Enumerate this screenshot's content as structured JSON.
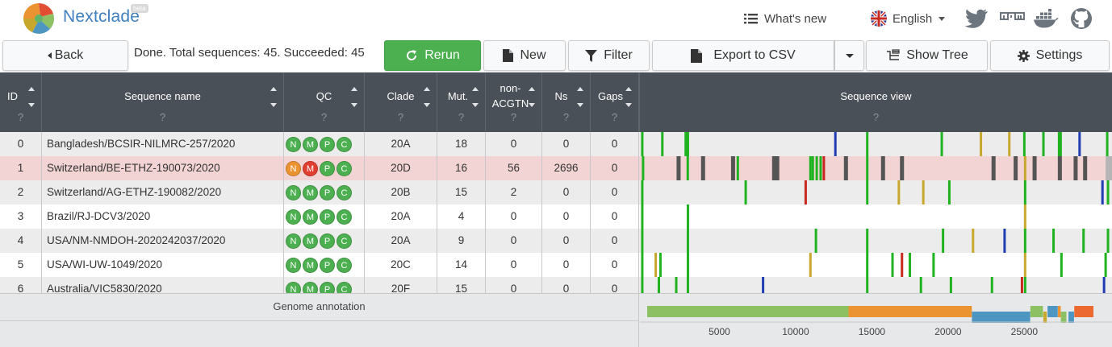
{
  "app": {
    "title": "Nextclade",
    "badge": "beta"
  },
  "nav": {
    "whats_new": "What's new",
    "language": "English"
  },
  "toolbar": {
    "back": "Back",
    "status": "Done. Total sequences: 45. Succeeded: 45",
    "rerun": "Rerun",
    "new": "New",
    "filter": "Filter",
    "export": "Export to CSV",
    "show_tree": "Show Tree",
    "settings": "Settings"
  },
  "table": {
    "headers": {
      "id": "ID",
      "name": "Sequence name",
      "qc": "QC",
      "clade": "Clade",
      "mut": "Mut.",
      "nonacgtn_1": "non-",
      "nonacgtn_2": "ACGTN",
      "ns": "Ns",
      "gaps": "Gaps",
      "seqview": "Sequence view",
      "help": "?"
    },
    "rows": [
      {
        "id": "0",
        "name": "Bangladesh/BCSIR-NILMRC-257/2020",
        "qc": [
          "N",
          "M",
          "P",
          "C"
        ],
        "qc_status": [
          "good",
          "good",
          "good",
          "good"
        ],
        "clade": "20A",
        "mut": "18",
        "nonacgtn": "0",
        "ns": "0",
        "gaps": "0",
        "highlight": false
      },
      {
        "id": "1",
        "name": "Switzerland/BE-ETHZ-190073/2020",
        "qc": [
          "N",
          "M",
          "P",
          "C"
        ],
        "qc_status": [
          "mediocre",
          "bad",
          "good",
          "good"
        ],
        "clade": "20D",
        "mut": "16",
        "nonacgtn": "56",
        "ns": "2696",
        "gaps": "0",
        "highlight": true
      },
      {
        "id": "2",
        "name": "Switzerland/AG-ETHZ-190082/2020",
        "qc": [
          "N",
          "M",
          "P",
          "C"
        ],
        "qc_status": [
          "good",
          "good",
          "good",
          "good"
        ],
        "clade": "20B",
        "mut": "15",
        "nonacgtn": "2",
        "ns": "0",
        "gaps": "0",
        "highlight": false
      },
      {
        "id": "3",
        "name": "Brazil/RJ-DCV3/2020",
        "qc": [
          "N",
          "M",
          "P",
          "C"
        ],
        "qc_status": [
          "good",
          "good",
          "good",
          "good"
        ],
        "clade": "20A",
        "mut": "4",
        "nonacgtn": "0",
        "ns": "0",
        "gaps": "0",
        "highlight": false
      },
      {
        "id": "4",
        "name": "USA/NM-NMDOH-2020242037/2020",
        "qc": [
          "N",
          "M",
          "P",
          "C"
        ],
        "qc_status": [
          "good",
          "good",
          "good",
          "good"
        ],
        "clade": "20A",
        "mut": "9",
        "nonacgtn": "0",
        "ns": "0",
        "gaps": "0",
        "highlight": false
      },
      {
        "id": "5",
        "name": "USA/WI-UW-1049/2020",
        "qc": [
          "N",
          "M",
          "P",
          "C"
        ],
        "qc_status": [
          "good",
          "good",
          "good",
          "good"
        ],
        "clade": "20C",
        "mut": "14",
        "nonacgtn": "0",
        "ns": "0",
        "gaps": "0",
        "highlight": false
      },
      {
        "id": "6",
        "name": "Australia/VIC5830/2020",
        "qc": [
          "N",
          "M",
          "P",
          "C"
        ],
        "qc_status": [
          "good",
          "good",
          "good",
          "good"
        ],
        "clade": "20F",
        "mut": "15",
        "nonacgtn": "0",
        "ns": "0",
        "gaps": "0",
        "highlight": false
      }
    ]
  },
  "sequence_view": {
    "genome_length": 29903,
    "colors": {
      "A": "#1fb31f",
      "C": "#1f3cb3",
      "G": "#c8a82c",
      "T": "#c8281f",
      "N": "#555555",
      "gap": "#b5b5b5"
    },
    "mutations": [
      [
        [
          150,
          "A"
        ],
        [
          1420,
          "A"
        ],
        [
          2900,
          "A"
        ],
        [
          3040,
          "A"
        ],
        [
          12380,
          "C"
        ],
        [
          14400,
          "A"
        ],
        [
          19120,
          "A"
        ],
        [
          21600,
          "G"
        ],
        [
          23400,
          "G"
        ],
        [
          24350,
          "A"
        ],
        [
          25560,
          "A"
        ],
        [
          26550,
          "A"
        ],
        [
          26650,
          "A"
        ],
        [
          27850,
          "C"
        ],
        [
          29600,
          "A"
        ]
      ],
      [
        [
          200,
          "A"
        ],
        [
          2450,
          "N"
        ],
        [
          3030,
          "A"
        ],
        [
          4000,
          "N"
        ],
        [
          5900,
          "N"
        ],
        [
          6200,
          "A"
        ],
        [
          8500,
          "N"
        ],
        [
          8700,
          "N"
        ],
        [
          10800,
          "A"
        ],
        [
          10950,
          "A"
        ],
        [
          11200,
          "A"
        ],
        [
          11450,
          "A"
        ],
        [
          11650,
          "T"
        ],
        [
          13050,
          "N"
        ],
        [
          14400,
          "A"
        ],
        [
          15400,
          "N"
        ],
        [
          16600,
          "N"
        ],
        [
          22400,
          "N"
        ],
        [
          23800,
          "N"
        ],
        [
          24400,
          "G"
        ],
        [
          25000,
          "N"
        ],
        [
          26600,
          "N"
        ],
        [
          27600,
          "N"
        ],
        [
          28200,
          "N"
        ]
      ],
      [
        [
          150,
          "A"
        ],
        [
          6700,
          "A"
        ],
        [
          10500,
          "T"
        ],
        [
          14400,
          "A"
        ],
        [
          16400,
          "G"
        ],
        [
          17950,
          "G"
        ],
        [
          19600,
          "A"
        ],
        [
          24400,
          "A"
        ],
        [
          29300,
          "C"
        ],
        [
          29650,
          "A"
        ]
      ],
      [
        [
          150,
          "A"
        ],
        [
          3040,
          "A"
        ],
        [
          24400,
          "G"
        ]
      ],
      [
        [
          150,
          "A"
        ],
        [
          3040,
          "A"
        ],
        [
          11150,
          "A"
        ],
        [
          14400,
          "A"
        ],
        [
          19200,
          "A"
        ],
        [
          21100,
          "G"
        ],
        [
          23100,
          "C"
        ],
        [
          24400,
          "A"
        ],
        [
          26200,
          "A"
        ],
        [
          28100,
          "A"
        ],
        [
          29650,
          "A"
        ]
      ],
      [
        [
          150,
          "A"
        ],
        [
          1000,
          "G"
        ],
        [
          1300,
          "A"
        ],
        [
          3040,
          "A"
        ],
        [
          10800,
          "G"
        ],
        [
          14400,
          "A"
        ],
        [
          16000,
          "A"
        ],
        [
          16600,
          "T"
        ],
        [
          17100,
          "A"
        ],
        [
          18600,
          "A"
        ],
        [
          24400,
          "G"
        ],
        [
          26700,
          "A"
        ],
        [
          29500,
          "A"
        ]
      ],
      [
        [
          150,
          "A"
        ],
        [
          1200,
          "A"
        ],
        [
          2300,
          "A"
        ],
        [
          3040,
          "A"
        ],
        [
          7800,
          "C"
        ],
        [
          14400,
          "A"
        ],
        [
          17800,
          "A"
        ],
        [
          19700,
          "A"
        ],
        [
          22300,
          "A"
        ],
        [
          24200,
          "T"
        ],
        [
          24400,
          "A"
        ],
        [
          29400,
          "C"
        ]
      ]
    ],
    "missing_ranges": [
      [
        null
      ],
      [
        [
          29500,
          29903
        ]
      ],
      [
        null
      ],
      [
        null
      ],
      [
        null
      ],
      [
        null
      ],
      [
        null
      ]
    ]
  },
  "genome_annotation": {
    "label": "Genome annotation",
    "genes": [
      {
        "start": 266,
        "end": 13468,
        "color": "#8cc063",
        "track": 0
      },
      {
        "start": 13468,
        "end": 21555,
        "color": "#ec9331",
        "track": 0
      },
      {
        "start": 21563,
        "end": 25384,
        "color": "#4e96c2",
        "track": 1
      },
      {
        "start": 25393,
        "end": 26220,
        "color": "#8cc063",
        "track": 0
      },
      {
        "start": 26245,
        "end": 26472,
        "color": "#c8a82c",
        "track": 1
      },
      {
        "start": 26523,
        "end": 27191,
        "color": "#4e96c2",
        "track": 0
      },
      {
        "start": 27202,
        "end": 27387,
        "color": "#ec9331",
        "track": 0
      },
      {
        "start": 27394,
        "end": 27759,
        "color": "#8cc063",
        "track": 1
      },
      {
        "start": 27894,
        "end": 28259,
        "color": "#4e96c2",
        "track": 1
      },
      {
        "start": 28274,
        "end": 29533,
        "color": "#ec6a31",
        "track": 0
      }
    ],
    "ticks": [
      "5000",
      "10000",
      "15000",
      "20000",
      "25000"
    ],
    "tick_values": [
      5000,
      10000,
      15000,
      20000,
      25000
    ]
  }
}
